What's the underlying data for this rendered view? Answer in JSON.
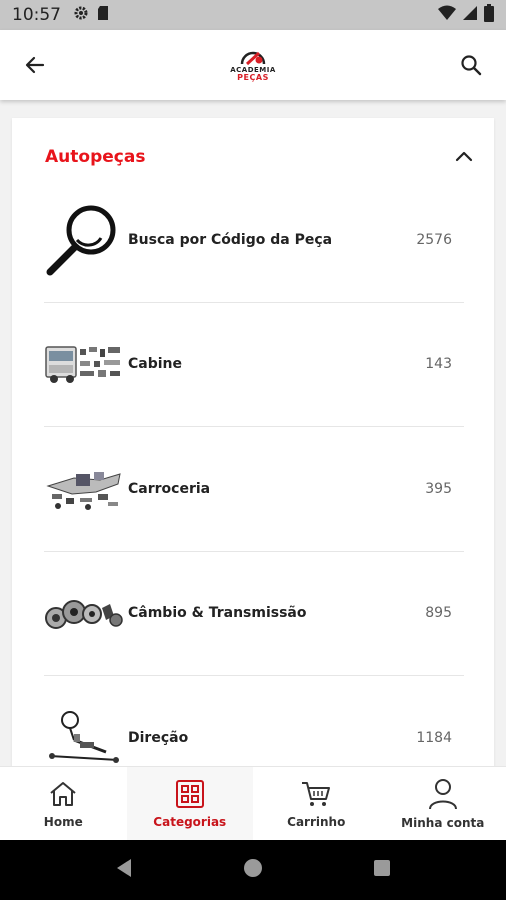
{
  "status_bar": {
    "time": "10:57"
  },
  "app_bar": {
    "logo_line1": "ACADEMIA",
    "logo_line2": "PEÇAS"
  },
  "section": {
    "title": "Autopeças",
    "items": [
      {
        "label": "Busca por Código da Peça",
        "count": "2576",
        "thumb": "magnifier-icon"
      },
      {
        "label": "Cabine",
        "count": "143",
        "thumb": "truck-cab-image"
      },
      {
        "label": "Carroceria",
        "count": "395",
        "thumb": "body-parts-image"
      },
      {
        "label": "Câmbio & Transmissão",
        "count": "895",
        "thumb": "gearbox-parts-image"
      },
      {
        "label": "Direção",
        "count": "1184",
        "thumb": "steering-parts-image"
      }
    ]
  },
  "bottom_nav": {
    "tabs": [
      {
        "label": "Home",
        "icon": "home-icon",
        "active": false
      },
      {
        "label": "Categorias",
        "icon": "grid-icon",
        "active": true
      },
      {
        "label": "Carrinho",
        "icon": "cart-icon",
        "active": false
      },
      {
        "label": "Minha conta",
        "icon": "user-icon",
        "active": false
      }
    ]
  },
  "colors": {
    "accent": "#e8141b",
    "active_tab": "#c8141b"
  }
}
